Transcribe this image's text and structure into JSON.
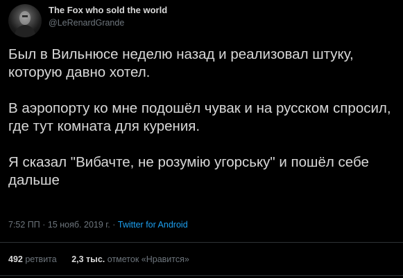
{
  "author": {
    "display_name": "The Fox who sold the world",
    "handle": "@LeRenardGrande"
  },
  "tweet": {
    "paragraphs": [
      "Был в Вильнюсе неделю назад и реализовал штуку, которую давно хотел.",
      "В аэропорту ко мне подошёл чувак и на русском спросил, где тут комната для курения.",
      "Я сказал \"Вибачте, не розумію угорську\" и пошёл себе дальше"
    ]
  },
  "meta": {
    "time": "7:52 ПП",
    "separator": " · ",
    "date": "15 нояб. 2019 г.",
    "source": "Twitter for Android"
  },
  "stats": {
    "retweets_count": "492",
    "retweets_label": "ретвита",
    "likes_count": "2,3 тыс.",
    "likes_label": "отметок «Нравится»"
  },
  "colors": {
    "background": "#000000",
    "text": "#d9d9d9",
    "secondary": "#6e767d",
    "accent": "#1da1f2",
    "divider": "#2f3336"
  },
  "icons": {
    "avatar": "user-avatar-photo"
  }
}
